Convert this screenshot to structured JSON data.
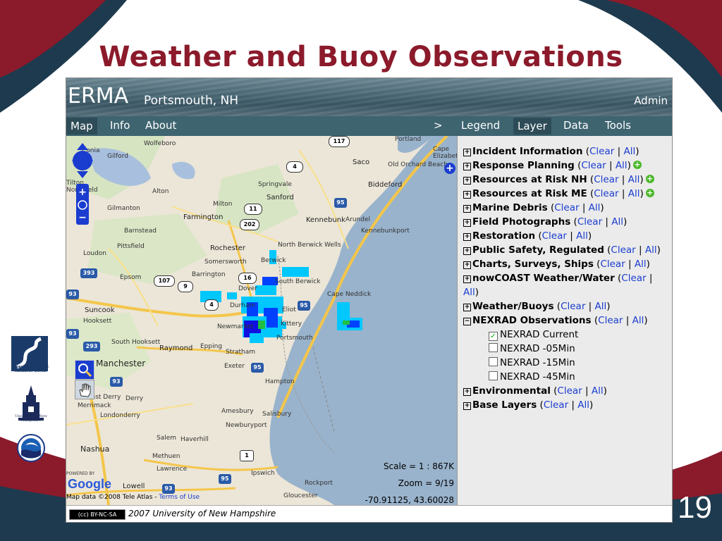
{
  "slide": {
    "title": "Weather and Buoy Observations",
    "page_number": "19",
    "logos": {
      "crc_text": "Coastal Response Research Center",
      "unh_text": "University of New Hampshire"
    }
  },
  "app": {
    "brand": "ERMA",
    "location": "Portsmouth, NH",
    "admin_label": "Admin",
    "nav_left": [
      {
        "label": "Map"
      },
      {
        "label": "Info"
      },
      {
        "label": "About"
      }
    ],
    "collapse_label": ">",
    "nav_right": [
      {
        "label": "Legend"
      },
      {
        "label": "Layer"
      },
      {
        "label": "Data"
      },
      {
        "label": "Tools"
      }
    ],
    "active_tab": "Layer"
  },
  "layers": {
    "clear_label": "Clear",
    "all_label": "All",
    "items": [
      {
        "name": "Incident Information",
        "state": "collapsed"
      },
      {
        "name": "Response Planning",
        "state": "collapsed",
        "add_icon": true
      },
      {
        "name": "Resources at Risk NH",
        "state": "collapsed",
        "add_icon": true
      },
      {
        "name": "Resources at Risk ME",
        "state": "collapsed",
        "add_icon": true
      },
      {
        "name": "Marine Debris",
        "state": "collapsed"
      },
      {
        "name": "Field Photographs",
        "state": "collapsed"
      },
      {
        "name": "Restoration",
        "state": "collapsed"
      },
      {
        "name": "Public Safety, Regulated",
        "state": "collapsed"
      },
      {
        "name": "Charts, Surveys, Ships",
        "state": "collapsed"
      },
      {
        "name": "nowCOAST Weather/Water",
        "state": "collapsed"
      },
      {
        "name": "Weather/Buoys",
        "state": "collapsed"
      },
      {
        "name": "NEXRAD Observations",
        "state": "expanded"
      },
      {
        "name": "Environmental",
        "state": "collapsed"
      },
      {
        "name": "Base Layers",
        "state": "collapsed"
      }
    ],
    "nexrad_options": [
      {
        "label": "NEXRAD Current",
        "checked": true
      },
      {
        "label": "NEXRAD -05Min",
        "checked": false
      },
      {
        "label": "NEXRAD -15Min",
        "checked": false
      },
      {
        "label": "NEXRAD -45Min",
        "checked": false
      }
    ]
  },
  "map": {
    "scale": "Scale = 1 : 867K",
    "zoom": "Zoom = 9/19",
    "coordinates": "-70.91125, 43.60028",
    "attribution": "Map data ©2008 Tele Atlas -",
    "terms_link": "Terms of Use",
    "powered_by": "POWERED BY",
    "google": "Google",
    "place_labels": [
      "Wolfeboro",
      "Gilford",
      "Northfield",
      "Alton",
      "Gilmanton",
      "Milton",
      "Sanford",
      "Springvale",
      "Farmington",
      "Barnstead",
      "Pittsfield",
      "Loudon",
      "Rochester",
      "Somersworth",
      "Barrington",
      "Epsom",
      "Dover",
      "Durham",
      "Newmarket",
      "Portsmouth",
      "Kittery",
      "Eliot",
      "Berwick",
      "North Berwick",
      "South Berwick",
      "Kennebunk",
      "Arundel",
      "Kennebunkport",
      "Wells",
      "Cape Neddick",
      "Biddeford",
      "Saco",
      "Old Orchard Beach",
      "Portland",
      "Cape Elizabeth",
      "Suncook",
      "Hooksett",
      "South Hooksett",
      "Raymond",
      "Epping",
      "Stratham",
      "Exeter",
      "Hampton",
      "Manchester",
      "East Derry",
      "Derry",
      "Merrimack",
      "Londonderry",
      "Salem",
      "Haverhill",
      "Amesbury",
      "Salisbury",
      "Newburyport",
      "Nashua",
      "Methuen",
      "Lawrence",
      "Ipswich",
      "Rockport",
      "Gloucester",
      "Lowell",
      "Tilton",
      "Conia"
    ],
    "road_shields": [
      "117",
      "4",
      "11",
      "202",
      "95",
      "16",
      "107",
      "9",
      "4",
      "95",
      "93",
      "393",
      "93",
      "293",
      "93",
      "95",
      "1",
      "95",
      "93",
      "95"
    ]
  },
  "footer": {
    "cc_badge": "(cc) BY-NC-SA",
    "copyright": "2007 University of New Hampshire"
  }
}
